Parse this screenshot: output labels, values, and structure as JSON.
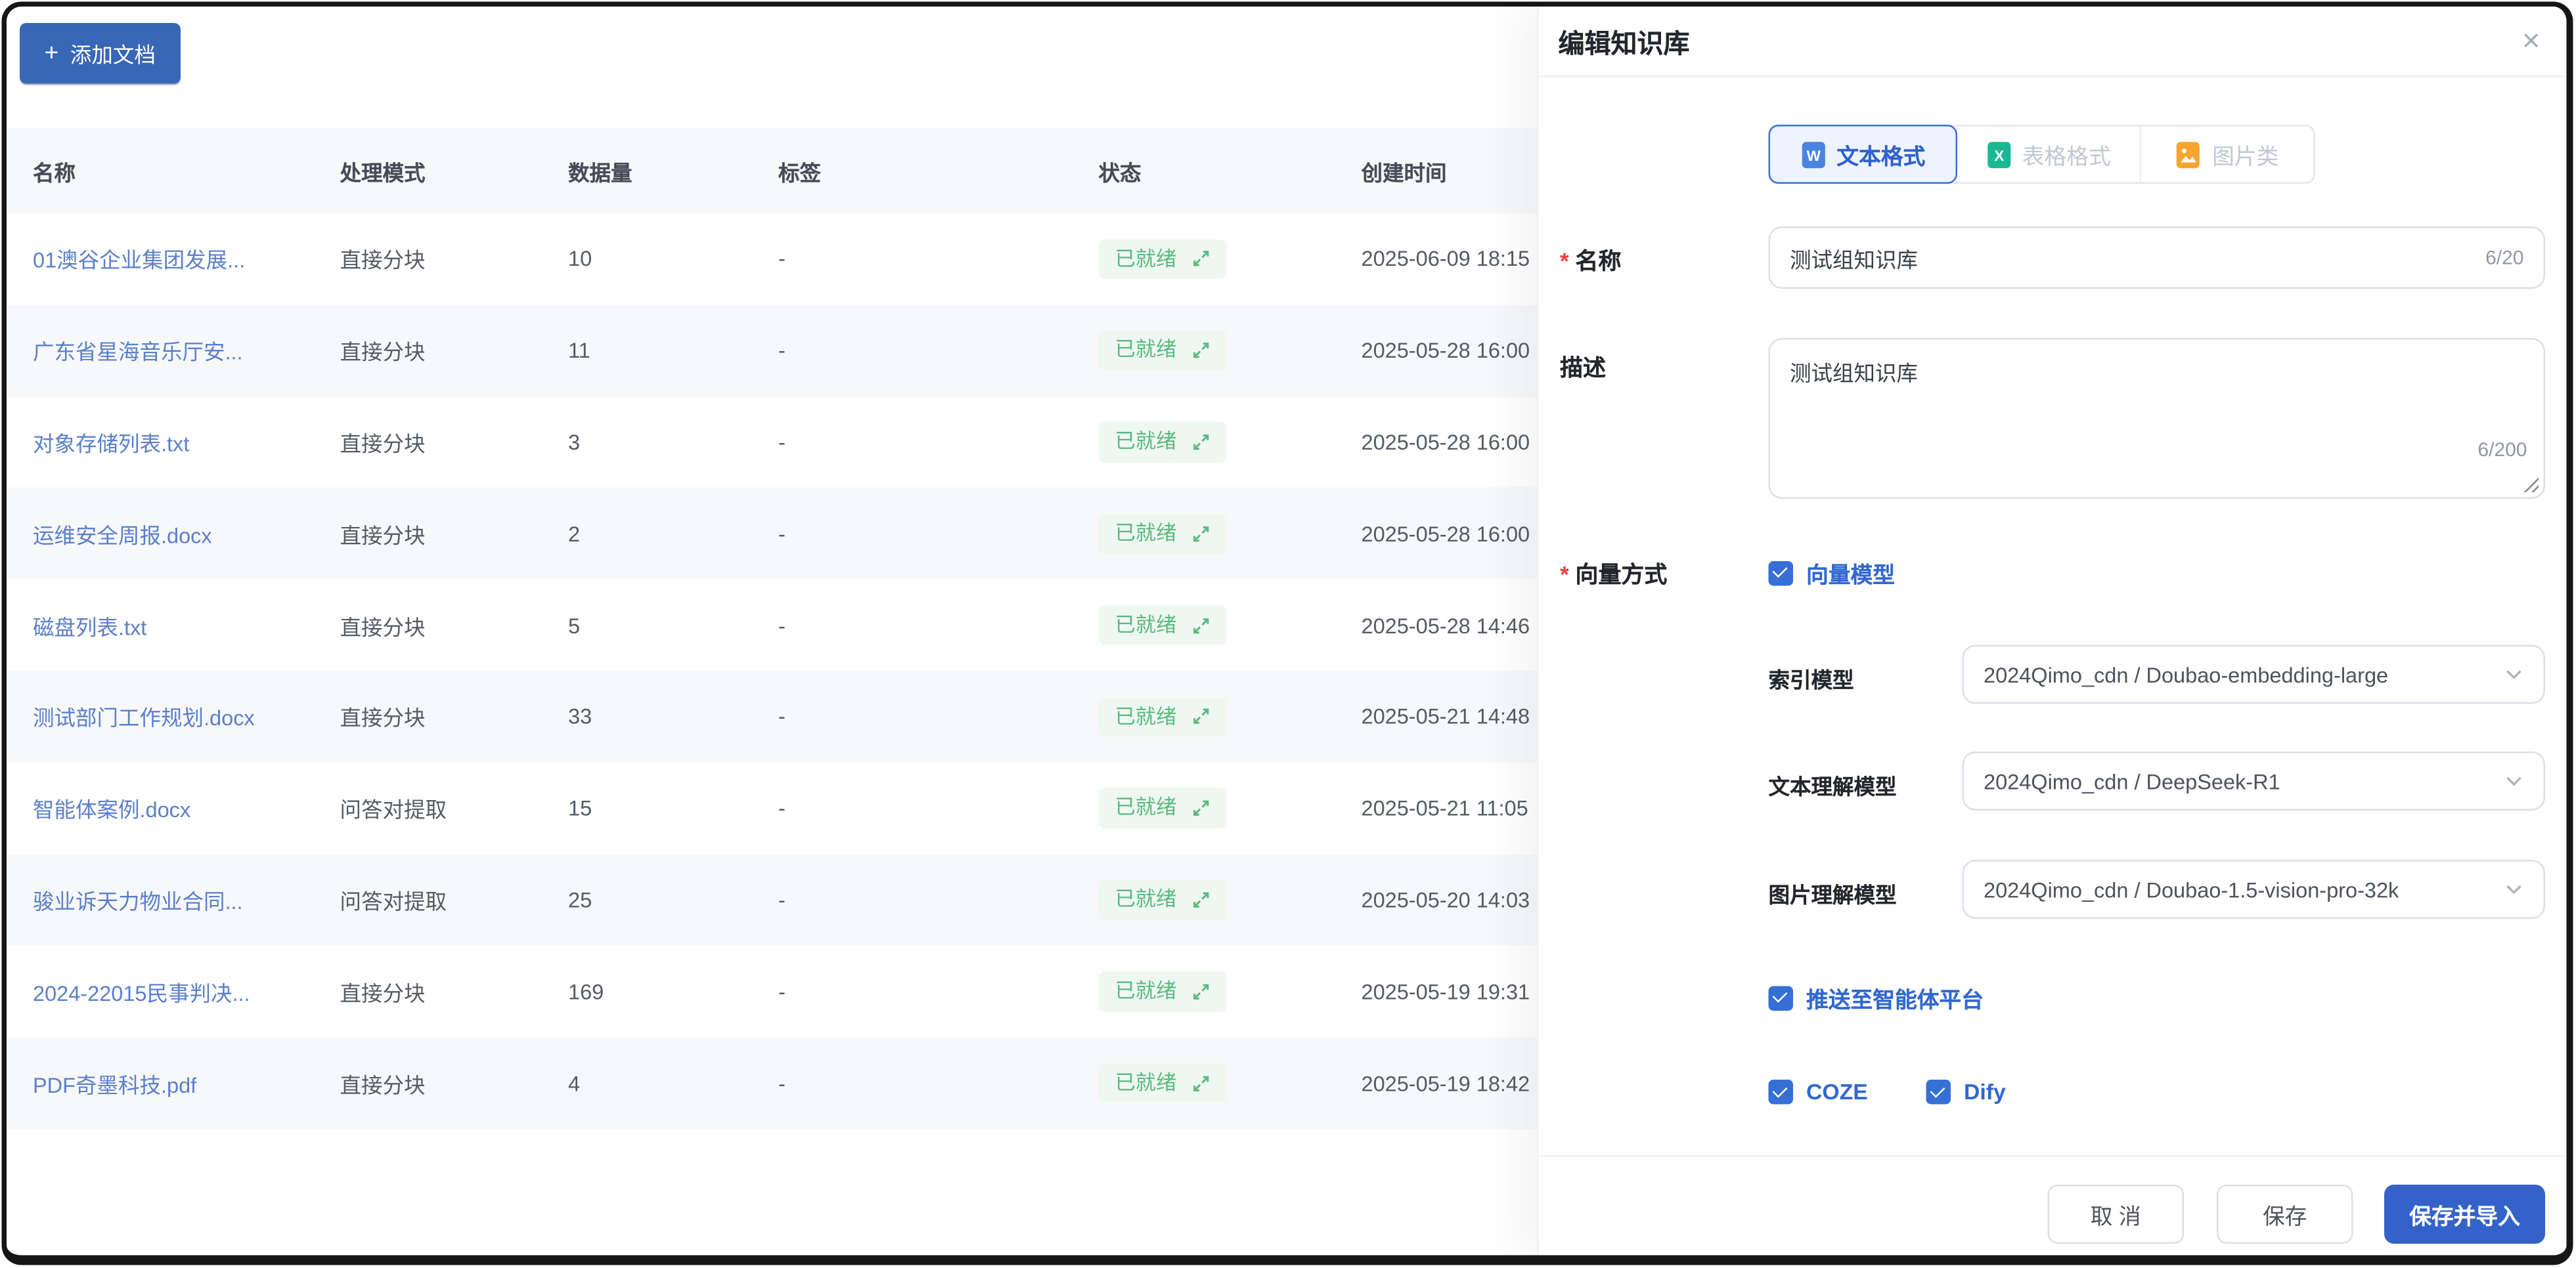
{
  "toolbar": {
    "add_doc_label": "添加文档",
    "add_doc_icon": "+"
  },
  "table": {
    "headers": [
      "名称",
      "处理模式",
      "数据量",
      "标签",
      "状态",
      "创建时间"
    ],
    "rows": [
      {
        "name": "01澳谷企业集团发展...",
        "mode": "直接分块",
        "count": "10",
        "tag": "-",
        "status": "已就绪",
        "created": "2025-06-09 18:15"
      },
      {
        "name": "广东省星海音乐厅安...",
        "mode": "直接分块",
        "count": "11",
        "tag": "-",
        "status": "已就绪",
        "created": "2025-05-28 16:00"
      },
      {
        "name": "对象存储列表.txt",
        "mode": "直接分块",
        "count": "3",
        "tag": "-",
        "status": "已就绪",
        "created": "2025-05-28 16:00"
      },
      {
        "name": "运维安全周报.docx",
        "mode": "直接分块",
        "count": "2",
        "tag": "-",
        "status": "已就绪",
        "created": "2025-05-28 16:00"
      },
      {
        "name": "磁盘列表.txt",
        "mode": "直接分块",
        "count": "5",
        "tag": "-",
        "status": "已就绪",
        "created": "2025-05-28 14:46"
      },
      {
        "name": "测试部门工作规划.docx",
        "mode": "直接分块",
        "count": "33",
        "tag": "-",
        "status": "已就绪",
        "created": "2025-05-21 14:48"
      },
      {
        "name": "智能体案例.docx",
        "mode": "问答对提取",
        "count": "15",
        "tag": "-",
        "status": "已就绪",
        "created": "2025-05-21 11:05"
      },
      {
        "name": "骏业诉天力物业合同...",
        "mode": "问答对提取",
        "count": "25",
        "tag": "-",
        "status": "已就绪",
        "created": "2025-05-20 14:03"
      },
      {
        "name": "2024-22015民事判决...",
        "mode": "直接分块",
        "count": "169",
        "tag": "-",
        "status": "已就绪",
        "created": "2025-05-19 19:31"
      },
      {
        "name": "PDF奇墨科技.pdf",
        "mode": "直接分块",
        "count": "4",
        "tag": "-",
        "status": "已就绪",
        "created": "2025-05-19 18:42"
      }
    ]
  },
  "drawer": {
    "title": "编辑知识库",
    "close_icon": "×",
    "tabs": [
      {
        "label": "文本格式",
        "icon": "word-doc-icon",
        "letter": "W",
        "color": "#4a84e0",
        "active": true
      },
      {
        "label": "表格格式",
        "icon": "excel-doc-icon",
        "letter": "X",
        "color": "#19b893",
        "active": false
      },
      {
        "label": "图片类",
        "icon": "image-doc-icon",
        "letter": "▲",
        "color": "#f6a52d",
        "active": false
      }
    ],
    "form": {
      "name_label": "名称",
      "name_value": "测试组知识库",
      "name_counter": "6/20",
      "desc_label": "描述",
      "desc_value": "测试组知识库",
      "desc_counter": "6/200",
      "vector_label": "向量方式",
      "vector_model_label": "向量模型",
      "index_model_label": "索引模型",
      "index_model_value": "2024Qimo_cdn / Doubao-embedding-large",
      "text_model_label": "文本理解模型",
      "text_model_value": "2024Qimo_cdn / DeepSeek-R1",
      "image_model_label": "图片理解模型",
      "image_model_value": "2024Qimo_cdn / Doubao-1.5-vision-pro-32k",
      "push_label": "推送至智能体平台",
      "coze_label": "COZE",
      "dify_label": "Dify"
    },
    "footer": {
      "cancel_label": "取 消",
      "save_label": "保存",
      "save_import_label": "保存并导入"
    }
  },
  "colors": {
    "primary_blue": "#3462c9",
    "add_button_blue": "#3767b6",
    "checkbox_blue": "#366fd6",
    "tab_active_blue": "#3a6fd8",
    "link_blue": "#5b7fca",
    "status_green": "#5cb87f",
    "status_bg_green": "#eef8f1",
    "word_icon_blue": "#4a84e0",
    "excel_icon_green": "#19b893",
    "image_icon_orange": "#f6a52d",
    "required_red": "#f0403c"
  }
}
